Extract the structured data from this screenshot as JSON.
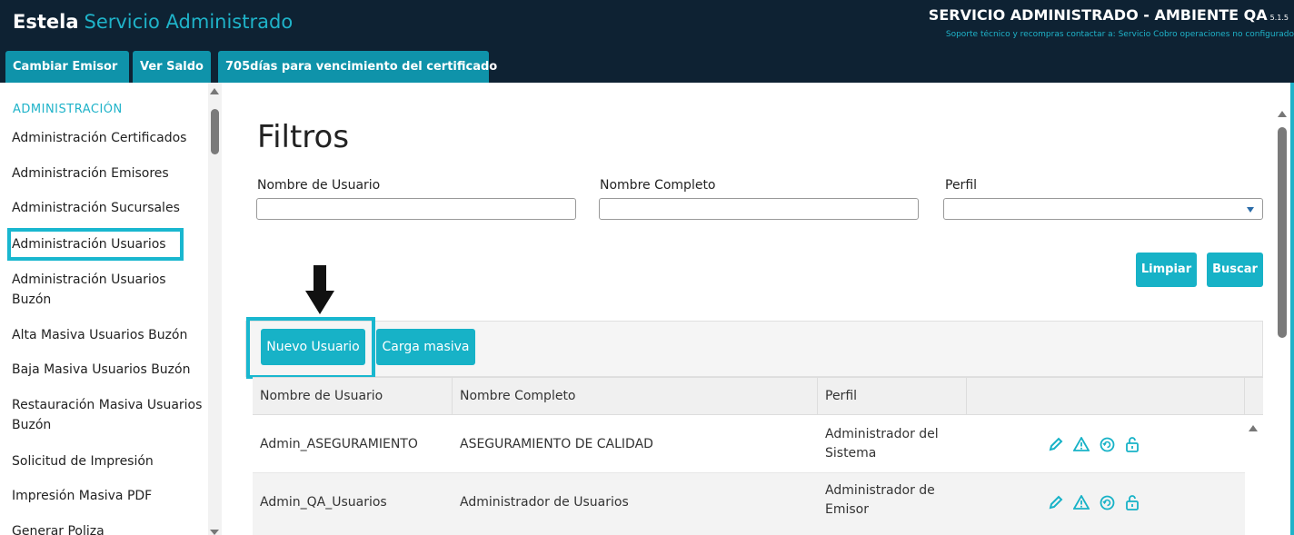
{
  "header": {
    "brand_bold": "Estela",
    "brand_light": "Servicio Administrado",
    "environment": "SERVICIO ADMINISTRADO - AMBIENTE QA",
    "version": "5.1.5",
    "support_text": "Soporte técnico y recompras contactar a: Servicio Cobro operaciones no configurado"
  },
  "tabs": [
    {
      "label": "Cambiar Emisor"
    },
    {
      "label": "Ver Saldo"
    },
    {
      "label": "705días para vencimiento del certificado"
    }
  ],
  "sidebar": {
    "section_title": "ADMINISTRACIÓN",
    "items": [
      {
        "label": "Administración Certificados"
      },
      {
        "label": "Administración Emisores"
      },
      {
        "label": "Administración Sucursales"
      },
      {
        "label": "Administración Usuarios",
        "selected": true
      },
      {
        "label": "Administración Usuarios Buzón"
      },
      {
        "label": "Alta Masiva Usuarios Buzón"
      },
      {
        "label": "Baja Masiva Usuarios Buzón"
      },
      {
        "label": "Restauración Masiva Usuarios Buzón"
      },
      {
        "label": "Solicitud de Impresión"
      },
      {
        "label": "Impresión Masiva PDF"
      },
      {
        "label": "Generar Poliza"
      }
    ]
  },
  "filters": {
    "title": "Filtros",
    "username_label": "Nombre de Usuario",
    "username_value": "",
    "fullname_label": "Nombre Completo",
    "fullname_value": "",
    "profile_label": "Perfil",
    "profile_value": "",
    "clear_label": "Limpiar",
    "search_label": "Buscar"
  },
  "toolbar": {
    "new_user_label": "Nuevo Usuario",
    "bulk_load_label": "Carga masiva"
  },
  "table": {
    "columns": [
      "Nombre de Usuario",
      "Nombre Completo",
      "Perfil",
      ""
    ],
    "rows": [
      {
        "username": "Admin_ASEGURAMIENTO",
        "fullname": "ASEGURAMIENTO DE CALIDAD",
        "profile": "Administrador del Sistema"
      },
      {
        "username": "Admin_QA_Usuarios",
        "fullname": "Administrador de Usuarios",
        "profile": "Administrador de Emisor"
      }
    ]
  },
  "colors": {
    "header_bg": "#0e2233",
    "accent": "#17b2c7",
    "tab_bg": "#0f93aa"
  },
  "icons": [
    "pencil-icon",
    "warning-icon",
    "refresh-icon",
    "unlock-icon",
    "arrow-down-icon"
  ]
}
